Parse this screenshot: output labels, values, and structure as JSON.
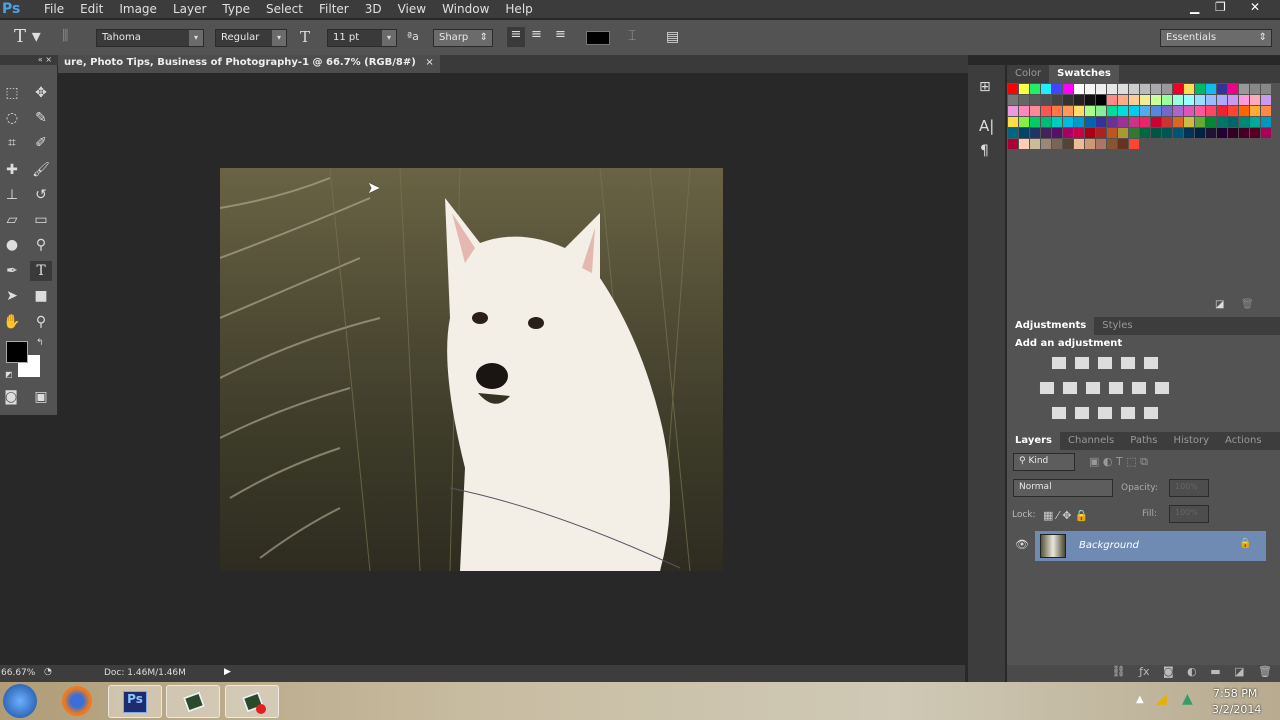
{
  "app": {
    "logo": "Ps"
  },
  "menu": [
    "File",
    "Edit",
    "Image",
    "Layer",
    "Type",
    "Select",
    "Filter",
    "3D",
    "View",
    "Window",
    "Help"
  ],
  "options": {
    "font_family": "Tahoma",
    "font_style": "Regular",
    "font_size": "11 pt",
    "antialias": "Sharp",
    "workspace": "Essentials",
    "text_color": "#000000"
  },
  "document": {
    "tab_title": "ure, Photo Tips, Business of Photography-1 @ 66.7% (RGB/8#)",
    "close": "×"
  },
  "status": {
    "zoom": "66.67%",
    "doc": "Doc: 1.46M/1.46M"
  },
  "swatches_panel": {
    "tabs": [
      "Color",
      "Swatches"
    ],
    "colors": [
      "#f00",
      "#ff4",
      "#2e6",
      "#2ef",
      "#44f",
      "#f0f",
      "#fff",
      "#f5f5f5",
      "#eee",
      "#e5e5e5",
      "#ddd",
      "#ccc",
      "#bbb",
      "#aaa",
      "#999",
      "#e02",
      "#fd5",
      "#0b6",
      "#1be",
      "#339",
      "#e08",
      "#999",
      "#888",
      "#888",
      "#777",
      "#666",
      "#5a5a5a",
      "#505050",
      "#444",
      "#333",
      "#222",
      "#111",
      "#000",
      "#f88",
      "#fa8",
      "#fc9",
      "#ee9",
      "#cf9",
      "#9f9",
      "#9fd",
      "#9ff",
      "#9df",
      "#9bf",
      "#aaf",
      "#c9e",
      "#f9d",
      "#fab",
      "#c9e",
      "#e9d",
      "#f8b",
      "#f89",
      "#f55",
      "#f74",
      "#f95",
      "#fd6",
      "#af8",
      "#8e9",
      "#0d9",
      "#0dd",
      "#0ce",
      "#5ae",
      "#58d",
      "#76c",
      "#a6c",
      "#d5b",
      "#f59",
      "#f46",
      "#e23",
      "#f43",
      "#f60",
      "#fa3",
      "#f84",
      "#fd4",
      "#8e4",
      "#0c6",
      "#0b7",
      "#0cb",
      "#0bd",
      "#09c",
      "#06a",
      "#339",
      "#639",
      "#939",
      "#c38",
      "#e26",
      "#c03",
      "#c33",
      "#d62",
      "#cb4",
      "#6a3",
      "#083",
      "#076",
      "#066",
      "#087",
      "#0a9",
      "#09b",
      "#068",
      "#046",
      "#236",
      "#425",
      "#516",
      "#a06",
      "#c04",
      "#a01",
      "#a22",
      "#b52",
      "#a93",
      "#373",
      "#064",
      "#054",
      "#055",
      "#057",
      "#035",
      "#024",
      "#213",
      "#203",
      "#302",
      "#402",
      "#502",
      "#a05",
      "#a03",
      "#fcb",
      "#cb9",
      "#987",
      "#765",
      "#543",
      "#eb9",
      "#c97",
      "#a76",
      "#853",
      "#632",
      "#f43"
    ]
  },
  "adjustments": {
    "tabs": [
      "Adjustments",
      "Styles"
    ],
    "heading": "Add an adjustment"
  },
  "layers": {
    "tabs": [
      "Layers",
      "Channels",
      "Paths",
      "History",
      "Actions"
    ],
    "filter": "Kind",
    "blend_mode": "Normal",
    "opacity_label": "Opacity:",
    "opacity": "100%",
    "lock_label": "Lock:",
    "fill_label": "Fill:",
    "fill": "100%",
    "items": [
      {
        "name": "Background",
        "visible": true,
        "locked": true
      }
    ]
  },
  "taskbar": {
    "time": "7:58 PM",
    "date": "3/2/2014",
    "ps_label": "Ps"
  }
}
